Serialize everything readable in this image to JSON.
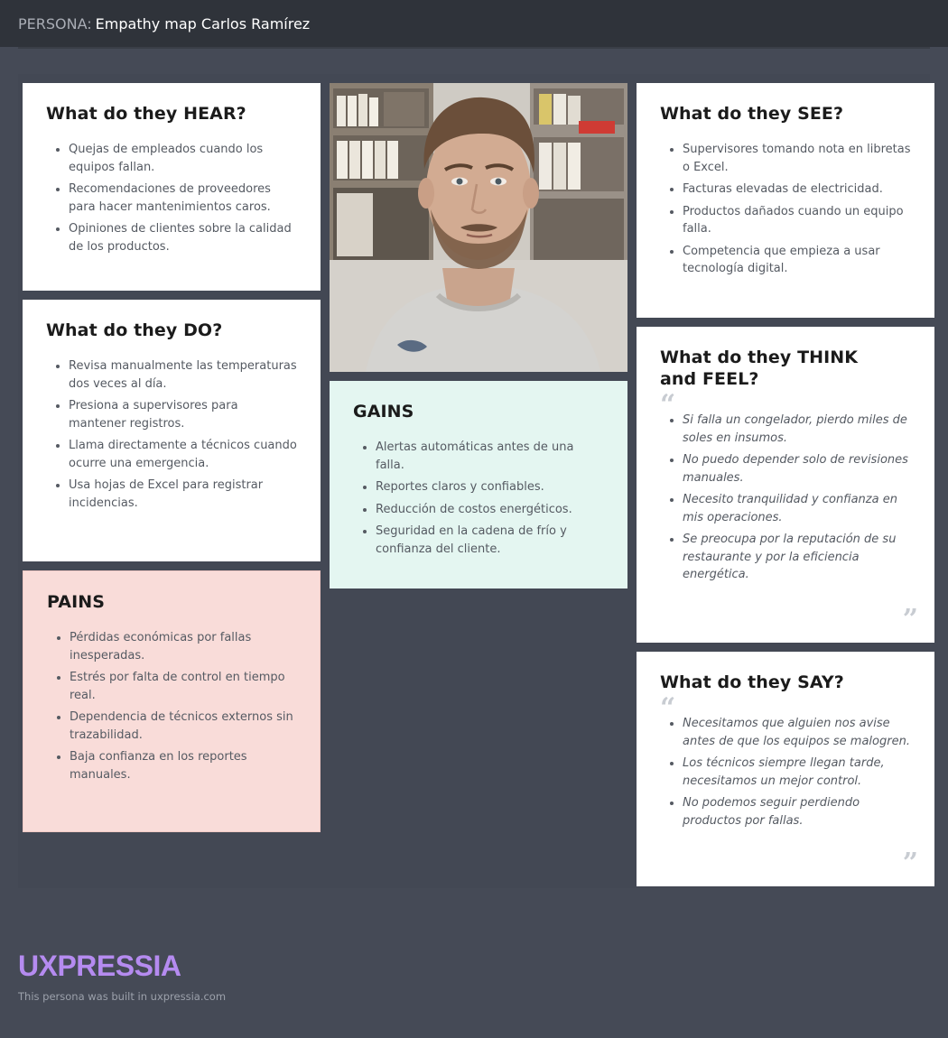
{
  "header": {
    "prefix": "PERSONA:",
    "title": "Empathy map Carlos Ramírez"
  },
  "hear": {
    "title": "What do they HEAR?",
    "items": [
      "Quejas de empleados cuando los equipos fallan.",
      "Recomendaciones de proveedores para hacer mantenimientos caros.",
      "Opiniones de clientes sobre la calidad de los productos."
    ]
  },
  "do": {
    "title": "What do they DO?",
    "items": [
      "Revisa manualmente las temperaturas dos veces al día.",
      "Presiona a supervisores para mantener registros.",
      "Llama directamente a técnicos cuando ocurre una emergencia.",
      "Usa hojas de Excel para registrar incidencias."
    ]
  },
  "pains": {
    "title": "PAINS",
    "items": [
      "Pérdidas económicas por fallas inesperadas.",
      "Estrés por falta de control en tiempo real.",
      "Dependencia de técnicos externos sin trazabilidad.",
      "Baja confianza en los reportes manuales."
    ]
  },
  "gains": {
    "title": "GAINS",
    "items": [
      "Alertas automáticas antes de una falla.",
      "Reportes claros y confiables.",
      "Reducción de costos energéticos.",
      "Seguridad en la cadena de frío y confianza del cliente."
    ]
  },
  "see": {
    "title": "What do they SEE?",
    "items": [
      "Supervisores tomando nota en libretas o Excel.",
      "Facturas elevadas de electricidad.",
      "Productos dañados cuando un equipo falla.",
      "Competencia que empieza a usar tecnología digital."
    ]
  },
  "think": {
    "title": "What do they THINK and FEEL?",
    "items": [
      "Si falla un congelador, pierdo miles de soles en insumos.",
      "No puedo depender solo de revisiones manuales.",
      "Necesito tranquilidad y confianza en mis operaciones.",
      "Se preocupa por la reputación de su restaurante y por la eficiencia energética."
    ]
  },
  "say": {
    "title": "What do they SAY?",
    "items": [
      "Necesitamos que alguien nos avise antes de que los equipos se malogren.",
      "Los técnicos siempre llegan tarde, necesitamos un mejor control.",
      "No podemos seguir perdiendo productos por fallas."
    ]
  },
  "footer": {
    "logo": "UXPRESSIA",
    "note": "This persona was built in uxpressia.com"
  },
  "colors": {
    "background": "#454a56",
    "pains": "#f9dcd9",
    "gains": "#e4f6f1",
    "brand": "#b58bf0"
  }
}
